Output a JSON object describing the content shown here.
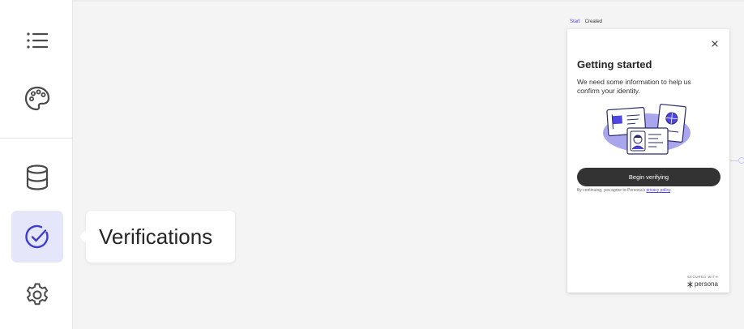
{
  "sidebar": {
    "items": [
      {
        "name": "list",
        "icon": "list-icon"
      },
      {
        "name": "theme",
        "icon": "palette-icon"
      },
      {
        "name": "database",
        "icon": "database-icon"
      },
      {
        "name": "verifications",
        "icon": "check-circle-icon",
        "active": true
      },
      {
        "name": "settings",
        "icon": "gear-icon"
      }
    ]
  },
  "tooltip": {
    "label": "Verifications"
  },
  "flow": {
    "tabs": [
      "Start",
      "Created"
    ]
  },
  "card": {
    "title": "Getting started",
    "description": "We need some information to help us confirm your identity.",
    "button_label": "Begin verifying",
    "consent_prefix": "By continuing, you agree to Persona's",
    "consent_link": "privacy policy",
    "consent_suffix": ".",
    "secured_label": "SECURED WITH",
    "brand": "persona"
  },
  "colors": {
    "accent": "#4f46e5",
    "active_bg": "#e6e6fb",
    "button_bg": "#333333",
    "illustration_blob": "#a9a6ee"
  }
}
